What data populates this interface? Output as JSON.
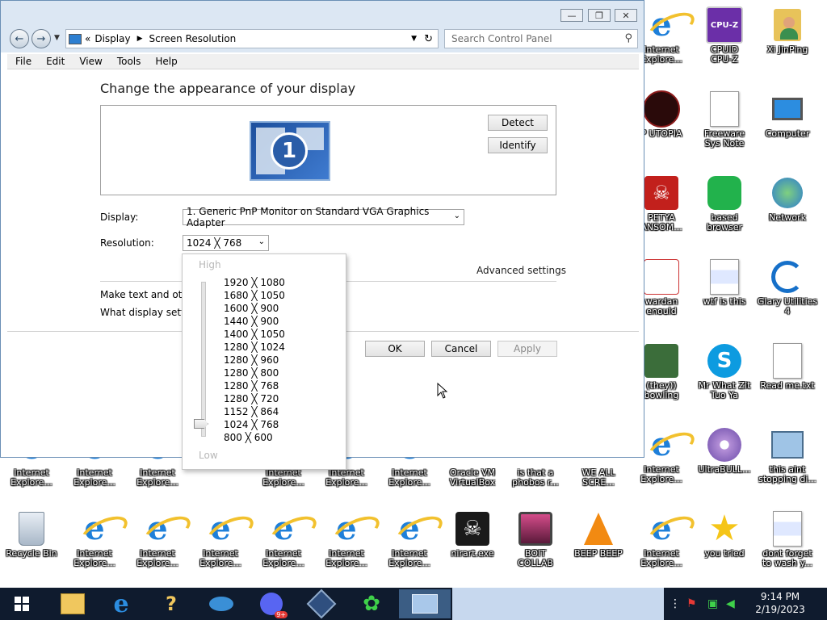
{
  "window": {
    "address": {
      "root": "Display",
      "current": "Screen Resolution",
      "sep_back": "«"
    },
    "search_placeholder": "Search Control Panel",
    "menu": [
      "File",
      "Edit",
      "View",
      "Tools",
      "Help"
    ]
  },
  "content": {
    "heading": "Change the appearance of your display",
    "monitor_number": "1",
    "detect_button": "Detect",
    "identify_button": "Identify",
    "display_label": "Display:",
    "display_value": "1. Generic PnP Monitor on Standard VGA Graphics Adapter",
    "resolution_label": "Resolution:",
    "resolution_value": "1024 ╳ 768",
    "advanced_settings": "Advanced settings",
    "text_size_link": "Make text and othe",
    "display_settings_link": "What display settin",
    "ok_button": "OK",
    "cancel_button": "Cancel",
    "apply_button": "Apply"
  },
  "resolution_dropdown": {
    "high_label": "High",
    "low_label": "Low",
    "options": [
      "1920 ╳ 1080",
      "1680 ╳ 1050",
      "1600 ╳ 900",
      "1440 ╳ 900",
      "1400 ╳ 1050",
      "1280 ╳ 1024",
      "1280 ╳ 960",
      "1280 ╳ 800",
      "1280 ╳ 768",
      "1280 ╳ 720",
      "1152 ╳ 864",
      "1024 ╳ 768",
      "800 ╳ 600"
    ],
    "selected": "1024 ╳ 768"
  },
  "desktop": {
    "icons": [
      {
        "label": "Internet\nExplore...",
        "icon": "internet-explorer-icon"
      },
      {
        "label": "CPUID\nCPU-Z",
        "icon": "cpuz-icon"
      },
      {
        "label": "Xi JinPing",
        "icon": "user-folder-icon"
      },
      {
        "label": "P UTOPIA",
        "icon": "utopia-icon"
      },
      {
        "label": "Freeware\nSys Note",
        "icon": "document-icon"
      },
      {
        "label": "Computer",
        "icon": "computer-icon"
      },
      {
        "label": "PETYA\nANSOM...",
        "icon": "skull-icon"
      },
      {
        "label": "based\nbrowser",
        "icon": "browser-icon"
      },
      {
        "label": "Network",
        "icon": "network-icon"
      },
      {
        "label": "wardan\nenould",
        "icon": "meme-icon"
      },
      {
        "label": "wtf is this",
        "icon": "html-document-icon"
      },
      {
        "label": "Glary Utilities\n4",
        "icon": "glary-utilities-icon"
      },
      {
        "label": "(they))\nbowling",
        "icon": "santa-icon"
      },
      {
        "label": "Mr What Zit\nTuo Ya",
        "icon": "skype-icon"
      },
      {
        "label": "Read me.txt",
        "icon": "text-file-icon"
      },
      {
        "label": "Internet\nExplore...",
        "icon": "internet-explorer-icon"
      },
      {
        "label": "UltraBULL...",
        "icon": "disc-icon"
      },
      {
        "label": "this aint\nstopping di...",
        "icon": "setup-icon"
      },
      {
        "label": "Internet\nExplore...",
        "icon": "internet-explorer-icon"
      },
      {
        "label": "Internet\nExplore...",
        "icon": "internet-explorer-icon"
      },
      {
        "label": "Internet\nExplore...",
        "icon": "internet-explorer-icon"
      },
      {
        "label": "Internet\nExplore...",
        "icon": "internet-explorer-icon"
      },
      {
        "label": "Internet\nExplore...",
        "icon": "internet-explorer-icon"
      },
      {
        "label": "Internet\nExplore...",
        "icon": "internet-explorer-icon"
      },
      {
        "label": "Oracle VM\nVirtualBox",
        "icon": "virtualbox-icon"
      },
      {
        "label": "is that a\nphobos r...",
        "icon": "phobos-icon"
      },
      {
        "label": "WE ALL\nSCRE...",
        "icon": "scream-icon"
      },
      {
        "label": "Recycle Bin",
        "icon": "recycle-bin-icon"
      },
      {
        "label": "Internet\nExplore...",
        "icon": "internet-explorer-icon"
      },
      {
        "label": "Internet\nExplore...",
        "icon": "internet-explorer-icon"
      },
      {
        "label": "Internet\nExplore...",
        "icon": "internet-explorer-icon"
      },
      {
        "label": "Internet\nExplore...",
        "icon": "internet-explorer-icon"
      },
      {
        "label": "Internet\nExplore...",
        "icon": "internet-explorer-icon"
      },
      {
        "label": "Internet\nExplore...",
        "icon": "internet-explorer-icon"
      },
      {
        "label": "nirart.exe",
        "icon": "skull-app-icon"
      },
      {
        "label": "BOIT\nCOLLAB",
        "icon": "crt-tv-icon"
      },
      {
        "label": "BEEP BEEP",
        "icon": "vlc-icon"
      },
      {
        "label": "Internet\nExplore...",
        "icon": "internet-explorer-icon"
      },
      {
        "label": "you tried",
        "icon": "star-icon"
      },
      {
        "label": "dont forget\nto wash y...",
        "icon": "html-document-icon"
      }
    ]
  },
  "taskbar": {
    "time": "9:14 PM",
    "date": "2/19/2023",
    "discord_badge": "9+",
    "apps": [
      "start-icon",
      "file-explorer-icon",
      "internet-explorer-icon",
      "help-icon",
      "fish-icon",
      "discord-icon",
      "virtualbox-icon",
      "clover-icon",
      "control-panel-icon"
    ]
  },
  "colors": {
    "accent": "#1e7fd9",
    "taskbar": "#0f1b2e",
    "window_chrome": "#dce7f3"
  }
}
